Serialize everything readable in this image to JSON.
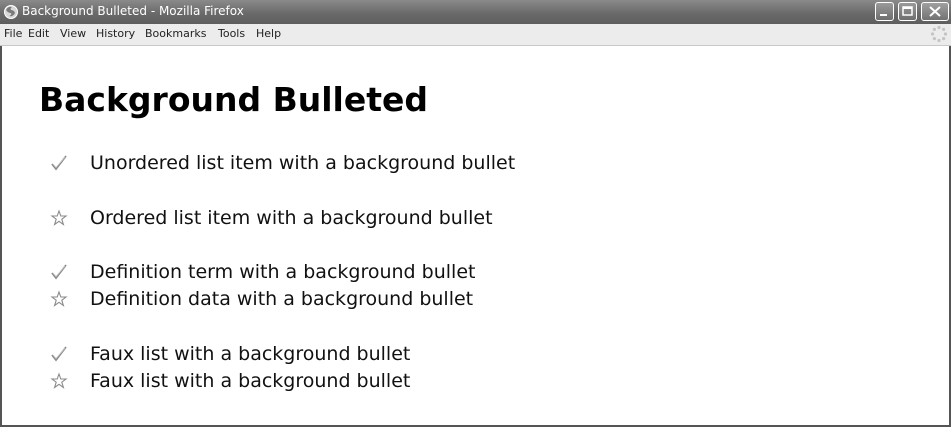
{
  "window": {
    "title": "Background Bulleted - Mozilla Firefox",
    "app_icon": "firefox-icon",
    "controls": [
      "minimize-icon",
      "maximize-icon",
      "close-icon"
    ]
  },
  "menubar": {
    "items": [
      {
        "label": "File"
      },
      {
        "label": "Edit"
      },
      {
        "label": "View"
      },
      {
        "label": "History"
      },
      {
        "label": "Bookmarks"
      },
      {
        "label": "Tools"
      },
      {
        "label": "Help"
      }
    ],
    "activity_icon": "throbber-icon"
  },
  "page": {
    "heading": "Background Bulleted",
    "unordered": {
      "icon": "checkmark-icon",
      "text": "Unordered list item with a background bullet"
    },
    "ordered": {
      "icon": "star-icon",
      "text": "Ordered list item with a background bullet"
    },
    "definition_term": {
      "icon": "checkmark-icon",
      "text": "Definition term with a background bullet"
    },
    "definition_data": {
      "icon": "star-icon",
      "text": "Definition data with a background bullet"
    },
    "faux_1": {
      "icon": "checkmark-icon",
      "text": "Faux list with a background bullet"
    },
    "faux_2": {
      "icon": "star-icon",
      "text": "Faux list with a background bullet"
    }
  },
  "colors": {
    "titlebar": "#6e6e6e",
    "menubar": "#ececec",
    "bullet": "#8a8a8a"
  }
}
